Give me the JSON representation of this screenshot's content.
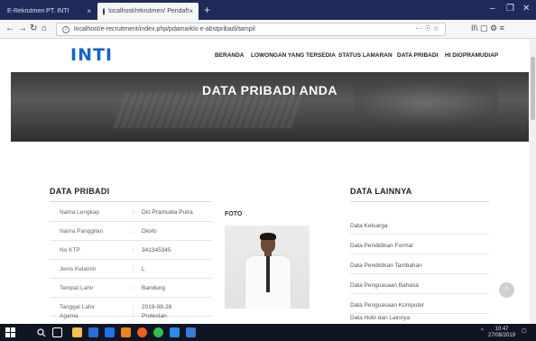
{
  "browser": {
    "tab1_title": "E-Rekrutmen PT. INTI",
    "tab2_title": "localhost/rekrutmen/ Pendaft",
    "new_tab": "+",
    "url": "localhost/e-recruitment/index.php/pdamarklo e-abstpribadi/tampil",
    "url_right": "··· ☉ ☆",
    "back": "←",
    "forward": "→",
    "reload": "↻",
    "home": "⌂",
    "tools": "II\\  ▢  ⚙  ≡",
    "win_min": "–",
    "win_max": "❐",
    "win_close": "✕",
    "tab_close": "×"
  },
  "site": {
    "logo_text": "INTI",
    "menu": [
      {
        "label": "BERANDA"
      },
      {
        "label": "LOWONGAN YANG TERSEDIA"
      },
      {
        "label": "STATUS LAMARAN"
      },
      {
        "label": "DATA PRIBADI"
      },
      {
        "label": "HI DIOPRAMUDIAP"
      }
    ]
  },
  "hero": {
    "title": "DATA PRIBADI ANDA"
  },
  "data_pribadi": {
    "title": "DATA PRIBADI",
    "foto_label": "FOTO",
    "rows": [
      {
        "key": "Nama Lengkap",
        "sep": ":",
        "value": "Dio Pramudia Putra"
      },
      {
        "key": "Nama Panggilan",
        "sep": ":",
        "value": "Dio/lo"
      },
      {
        "key": "No KTP",
        "sep": ":",
        "value": "341345345"
      },
      {
        "key": "Jenis Kelamin",
        "sep": ":",
        "value": "L"
      },
      {
        "key": "Tempat Lahir",
        "sep": ":",
        "value": "Bandung"
      },
      {
        "key": "Tanggal Lahir",
        "sep": ":",
        "value": "2019-08-28"
      },
      {
        "key": "Agama",
        "sep": ":",
        "value": "Protestan"
      }
    ]
  },
  "data_lainnya": {
    "title": "DATA LAINNYA",
    "links": [
      {
        "label": "Data Keluarga"
      },
      {
        "label": "Data Pendidikan Formal"
      },
      {
        "label": "Data Pendidikan Tambahan"
      },
      {
        "label": "Data Penguasaan Bahasa"
      },
      {
        "label": "Data Penguasaan Komputer"
      },
      {
        "label": "Data Hobi dan Lainnya"
      }
    ]
  },
  "fab_icon": "^",
  "taskbar": {
    "time": "10:47",
    "date": "27/08/2019",
    "chevron": "^",
    "notif": "▢"
  },
  "colors": {
    "brand_blue": "#1565c0",
    "brand_red": "#e53935",
    "tabbar": "#1e2a5a",
    "taskbar": "#101522"
  }
}
